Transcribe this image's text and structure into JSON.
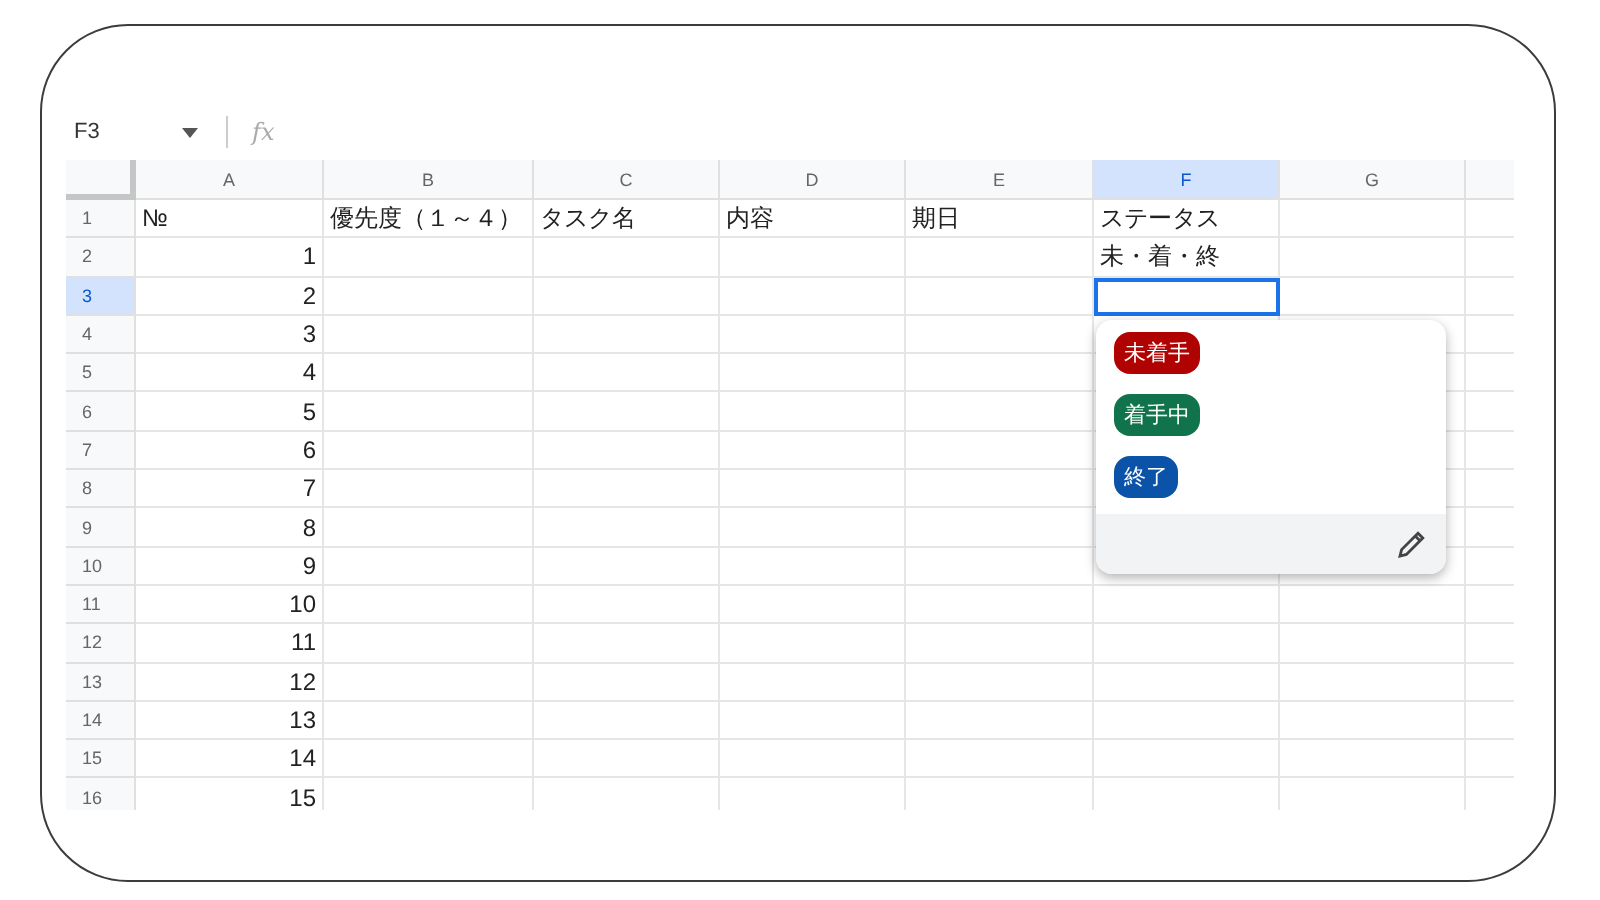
{
  "name_box": "F3",
  "formula_icon": "fx",
  "columns": [
    {
      "label": "A",
      "selected": false
    },
    {
      "label": "B",
      "selected": false
    },
    {
      "label": "C",
      "selected": false
    },
    {
      "label": "D",
      "selected": false
    },
    {
      "label": "E",
      "selected": false
    },
    {
      "label": "F",
      "selected": true
    },
    {
      "label": "G",
      "selected": false
    }
  ],
  "rows": [
    {
      "header": "1",
      "selected": false,
      "a": "№",
      "b": "優先度（１～４）",
      "c": "タスク名",
      "d": "内容",
      "e": "期日",
      "f": "ステータス"
    },
    {
      "header": "2",
      "selected": false,
      "a": "1",
      "f": "未・着・終"
    },
    {
      "header": "3",
      "selected": true,
      "a": "2"
    },
    {
      "header": "4",
      "selected": false,
      "a": "3"
    },
    {
      "header": "5",
      "selected": false,
      "a": "4"
    },
    {
      "header": "6",
      "selected": false,
      "a": "5"
    },
    {
      "header": "7",
      "selected": false,
      "a": "6"
    },
    {
      "header": "8",
      "selected": false,
      "a": "7"
    },
    {
      "header": "9",
      "selected": false,
      "a": "8"
    },
    {
      "header": "10",
      "selected": false,
      "a": "9"
    },
    {
      "header": "11",
      "selected": false,
      "a": "10"
    },
    {
      "header": "12",
      "selected": false,
      "a": "11"
    },
    {
      "header": "13",
      "selected": false,
      "a": "12"
    },
    {
      "header": "14",
      "selected": false,
      "a": "13"
    },
    {
      "header": "15",
      "selected": false,
      "a": "14"
    },
    {
      "header": "16",
      "selected": false,
      "a": "15"
    }
  ],
  "dropdown": {
    "options": [
      {
        "label": "未着手",
        "color": "#b10202"
      },
      {
        "label": "着手中",
        "color": "#11734b"
      },
      {
        "label": "終了",
        "color": "#0a53a8"
      }
    ]
  }
}
